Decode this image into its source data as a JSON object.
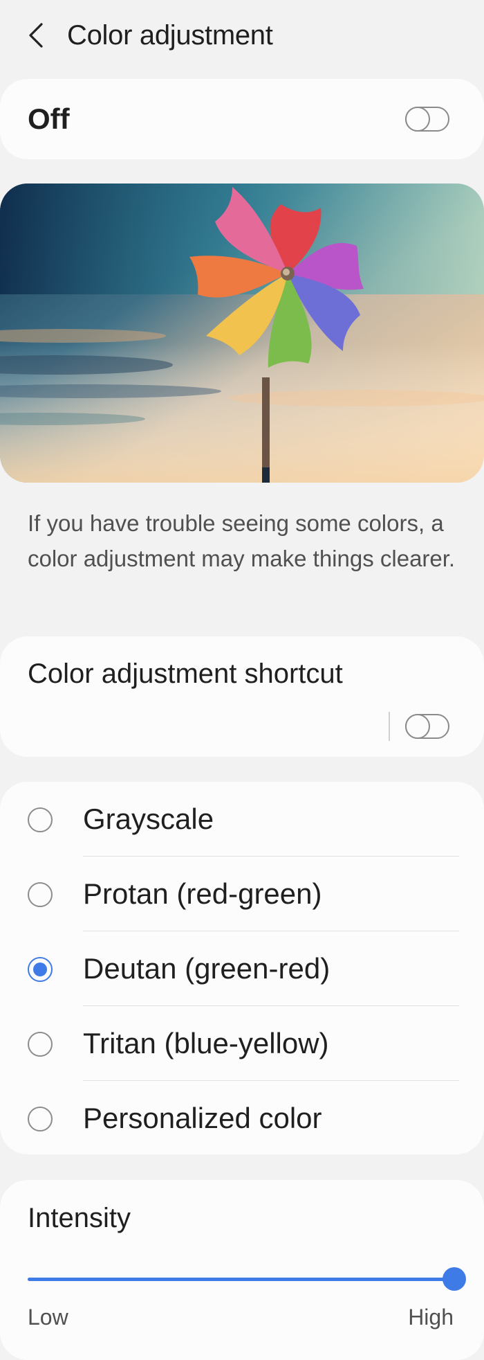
{
  "header": {
    "title": "Color adjustment",
    "back_icon": "chevron-left-icon"
  },
  "master_toggle": {
    "label": "Off",
    "on": false
  },
  "preview": {
    "icon": "pinwheel-sky-image"
  },
  "description": "If you have trouble seeing some colors, a color adjustment may make things clearer.",
  "shortcut": {
    "label": "Color adjustment shortcut",
    "on": false
  },
  "options": [
    {
      "label": "Grayscale",
      "selected": false
    },
    {
      "label": "Protan (red-green)",
      "selected": false
    },
    {
      "label": "Deutan (green-red)",
      "selected": true
    },
    {
      "label": "Tritan (blue-yellow)",
      "selected": false
    },
    {
      "label": "Personalized color",
      "selected": false
    }
  ],
  "intensity": {
    "label": "Intensity",
    "low_label": "Low",
    "high_label": "High",
    "value": 1.0
  },
  "colors": {
    "accent": "#3e7be6",
    "background": "#f2f2f2",
    "card": "#fcfcfc"
  }
}
